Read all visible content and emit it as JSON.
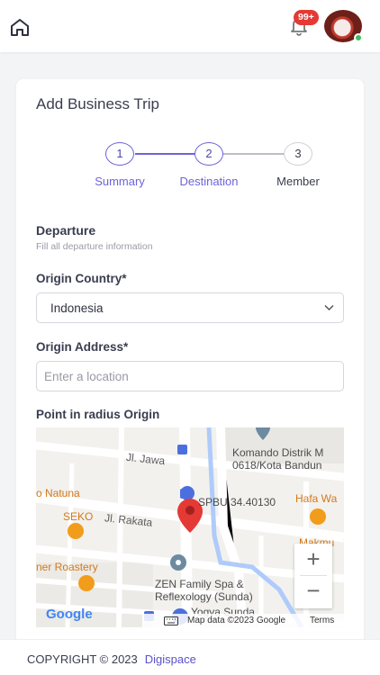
{
  "header": {
    "notification_badge": "99+",
    "accent_color": "#6c63d9"
  },
  "form": {
    "title": "Add Business Trip",
    "steps": [
      {
        "number": "1",
        "label": "Summary",
        "state": "done"
      },
      {
        "number": "2",
        "label": "Destination",
        "state": "current"
      },
      {
        "number": "3",
        "label": "Member",
        "state": "upcoming"
      }
    ],
    "section": {
      "title": "Departure",
      "subtitle": "Fill all departure information"
    },
    "origin_country": {
      "label": "Origin Country*",
      "value": "Indonesia"
    },
    "origin_address": {
      "label": "Origin Address*",
      "value": "",
      "placeholder": "Enter a location"
    },
    "map": {
      "label": "Point in radius Origin",
      "place_labels": {
        "street_jawa": "Jl. Jawa",
        "komando": "Komando Distrik M",
        "komando2": "0618/Kota Bandun",
        "natuna": "o Natuna",
        "spbu": "SPBU 34.40130",
        "hafa": "Hafa Wa",
        "seko": "SEKO",
        "street_rakata": "Jl. Rakata",
        "makmur": "Makmu",
        "roastery": "ner Roastery",
        "zen1": "ZEN Family Spa &",
        "zen2": "Reflexology (Sunda)",
        "yogya": "Yogya Sunda"
      },
      "zoom_in": "+",
      "zoom_out": "−",
      "google": "Google",
      "attribution": "Map data ©2023 Google",
      "terms": "Terms"
    }
  },
  "footer": {
    "copyright": "COPYRIGHT © 2023",
    "link": "Digispace"
  }
}
